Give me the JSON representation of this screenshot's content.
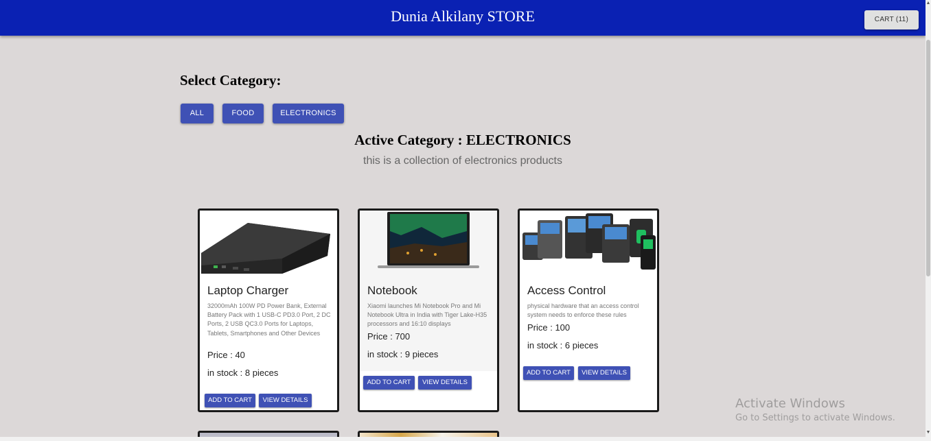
{
  "header": {
    "store_title": "Dunia Alkilany STORE",
    "cart_label": "CART (11)",
    "color": "#0a21b3"
  },
  "categories": {
    "heading": "Select Category:",
    "buttons": [
      {
        "label": "ALL"
      },
      {
        "label": "FOOD"
      },
      {
        "label": "ELECTRONICS"
      }
    ],
    "active_title": "Active Category : ELECTRONICS",
    "active_description": "this is a collection of electronics products"
  },
  "products": [
    {
      "name": "Laptop Charger",
      "description": "32000mAh 100W PD Power Bank, External Battery Pack with 1 USB-C PD3.0 Port, 2 DC Ports, 2 USB QC3.0 Ports for Laptops, Tablets, Smartphones and Other Devices",
      "price": "Price : 40",
      "stock": "in stock : 8 pieces",
      "add_label": "ADD TO CART",
      "details_label": "VIEW DETAILS"
    },
    {
      "name": "Notebook",
      "description": "Xiaomi launches Mi Notebook Pro and Mi Notebook Ultra in India with Tiger Lake-H35 processors and 16:10 displays",
      "price": "Price : 700",
      "stock": "in stock : 9 pieces",
      "add_label": "ADD TO CART",
      "details_label": "VIEW DETAILS"
    },
    {
      "name": "Access Control",
      "description": "physical hardware that an access control system needs to enforce these rules",
      "price": "Price : 100",
      "stock": "in stock : 6 pieces",
      "add_label": "ADD TO CART",
      "details_label": "VIEW DETAILS"
    }
  ],
  "watermark": {
    "title": "Activate Windows",
    "subtitle": "Go to Settings to activate Windows."
  }
}
